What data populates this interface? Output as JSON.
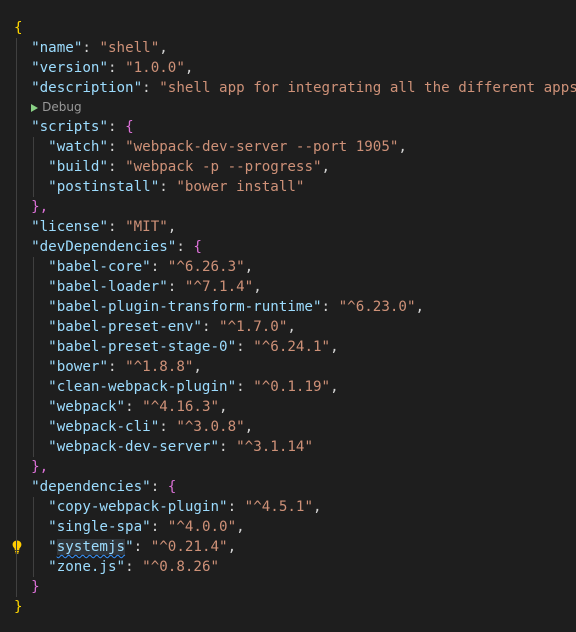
{
  "editor": {
    "language": "json",
    "codelens": {
      "label": "Debug",
      "icon": "play-icon"
    },
    "colors": {
      "background": "#1e1e1e",
      "key": "#9cdcfe",
      "string": "#ce9178",
      "punctuation": "#d4d4d4",
      "bracket_level1": "#ffd700",
      "bracket_level2": "#da70d6",
      "codelens_play": "#89d185",
      "lightbulb": "#ffcc00"
    },
    "lines": [
      {
        "text": "{"
      },
      {
        "key": "name",
        "value": "shell"
      },
      {
        "key": "version",
        "value": "1.0.0"
      },
      {
        "key": "description",
        "value": "shell app for integrating all the different apps"
      },
      {
        "codelens": "Debug"
      },
      {
        "key": "scripts",
        "open": "{"
      },
      {
        "key": "watch",
        "value": "webpack-dev-server --port 1905"
      },
      {
        "key": "build",
        "value": "webpack -p --progress"
      },
      {
        "key": "postinstall",
        "value": "bower install"
      },
      {
        "text": "},"
      },
      {
        "key": "license",
        "value": "MIT"
      },
      {
        "key": "devDependencies",
        "open": "{"
      },
      {
        "key": "babel-core",
        "value": "^6.26.3"
      },
      {
        "key": "babel-loader",
        "value": "^7.1.4"
      },
      {
        "key": "babel-plugin-transform-runtime",
        "value": "^6.23.0"
      },
      {
        "key": "babel-preset-env",
        "value": "^1.7.0"
      },
      {
        "key": "babel-preset-stage-0",
        "value": "^6.24.1"
      },
      {
        "key": "bower",
        "value": "^1.8.8"
      },
      {
        "key": "clean-webpack-plugin",
        "value": "^0.1.19"
      },
      {
        "key": "webpack",
        "value": "^4.16.3"
      },
      {
        "key": "webpack-cli",
        "value": "^3.0.8"
      },
      {
        "key": "webpack-dev-server",
        "value": "^3.1.14"
      },
      {
        "text": "},"
      },
      {
        "key": "dependencies",
        "open": "{"
      },
      {
        "key": "copy-webpack-plugin",
        "value": "^4.5.1"
      },
      {
        "key": "single-spa",
        "value": "^4.0.0"
      },
      {
        "key": "systemjs",
        "value": "^0.21.4",
        "warning": "lightbulb-icon"
      },
      {
        "key": "zone.js",
        "value": "^0.8.26"
      },
      {
        "text": "}"
      },
      {
        "text": "}"
      }
    ]
  }
}
